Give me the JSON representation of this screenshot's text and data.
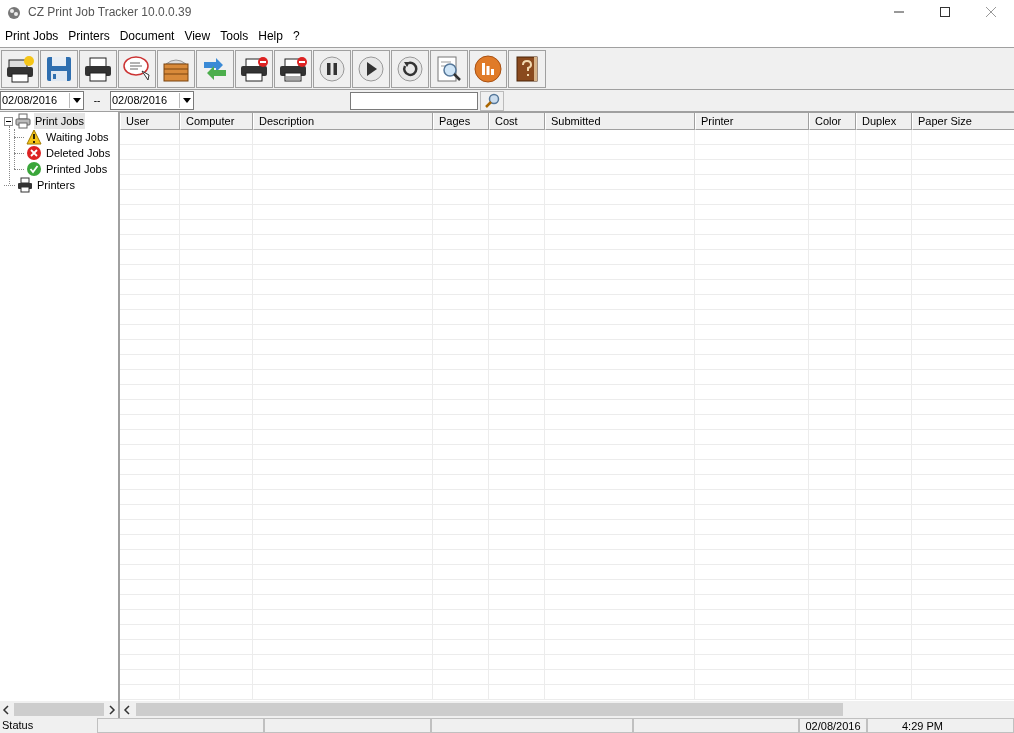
{
  "window": {
    "title": "CZ Print Job Tracker 10.0.0.39"
  },
  "menu": [
    "Print Jobs",
    "Printers",
    "Document",
    "View",
    "Tools",
    "Help",
    "?"
  ],
  "toolbar": [
    {
      "kind": "printer-star"
    },
    {
      "kind": "save"
    },
    {
      "kind": "printer"
    },
    {
      "kind": "comment"
    },
    {
      "kind": "box"
    },
    {
      "kind": "refresh-arrows"
    },
    {
      "kind": "printer-stop"
    },
    {
      "kind": "printer-stop2"
    },
    {
      "kind": "pause"
    },
    {
      "kind": "play"
    },
    {
      "kind": "reload"
    },
    {
      "kind": "preview"
    },
    {
      "kind": "chart"
    },
    {
      "kind": "help-book"
    }
  ],
  "filter": {
    "date_from": "02/08/2016",
    "separator": "--",
    "date_to": "02/08/2016"
  },
  "tree": [
    {
      "label": "Print Jobs",
      "kind": "printer",
      "expanded": true,
      "selected": true,
      "children": [
        {
          "label": "Waiting Jobs",
          "kind": "warning",
          "selected": false
        },
        {
          "label": "Deleted Jobs",
          "kind": "error",
          "selected": false
        },
        {
          "label": "Printed Jobs",
          "kind": "ok",
          "selected": false
        }
      ]
    },
    {
      "label": "Printers",
      "kind": "printer-dark",
      "selected": false
    }
  ],
  "table": {
    "columns": [
      "User",
      "Computer",
      "Description",
      "Pages",
      "Cost",
      "Submitted",
      "Printer",
      "Color",
      "Duplex",
      "Paper Size"
    ]
  },
  "status_bar": {
    "label": "Status",
    "date": "02/08/2016",
    "time": "4:29 PM"
  }
}
